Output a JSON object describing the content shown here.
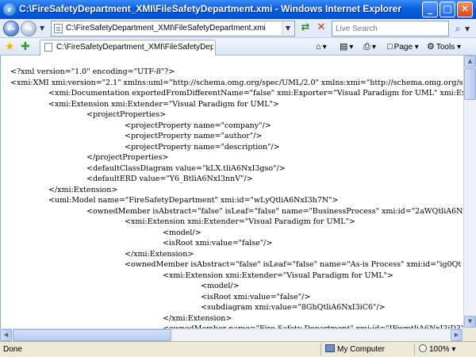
{
  "window": {
    "title": "C:\\FireSafetyDepartment_XMI\\FileSafetyDepartment.xmi - Windows Internet Explorer",
    "app_icon": "e",
    "minimize": "_",
    "maximize": "□",
    "close": "✕"
  },
  "nav": {
    "back_icon": "back-arrow-icon",
    "forward_icon": "forward-arrow-icon",
    "address": "C:\\FireSafetyDepartment_XMI\\FileSafetyDepartment.xmi",
    "search_placeholder": "Live Search"
  },
  "tabs": [
    {
      "title": "C:\\FireSafetyDepartment_XMI\\FileSafetyDepartment...."
    }
  ],
  "commands": {
    "page": "Page",
    "tools": "Tools"
  },
  "xml_lines": [
    "<?xml version=\"1.0\" encoding=\"UTF-8\"?>",
    "<xmi:XMI xmi:version=\"2.1\" xmlns:uml=\"http://schema.omg.org/spec/UML/2.0\" xmlns:xmi=\"http://schema.omg.org/sp",
    "<xmi:Documentation exportedFromDifferentName=\"false\" xmi:Exporter=\"Visual Paradigm for UML\" xmi:Expo",
    "<xmi:Extension xmi:Extender=\"Visual Paradigm for UML\">",
    "<projectProperties>",
    "<projectProperty name=\"company\"/>",
    "<projectProperty name=\"author\"/>",
    "<projectProperty name=\"description\"/>",
    "</projectProperties>",
    "<defaultClassDiagram value=\"kLX.tliA6NxI3gso\"/>",
    "<defaultERD value=\"Y6_BtliA6NxI3nnV\"/>",
    "</xmi:Extension>",
    "<uml:Model name=\"FireSafetyDepartment\" xmi:id=\"wLyQtliA6NxI3h7N\">",
    "<ownedMember isAbstract=\"false\" isLeaf=\"false\" name=\"BusinessProcess\" xmi:id=\"2aWQtliA6NxI3",
    "<xmi:Extension xmi:Extender=\"Visual Paradigm for UML\">",
    "<model/>",
    "<isRoot xmi:value=\"false\"/>",
    "</xmi:Extension>",
    "<ownedMember isAbstract=\"false\" isLeaf=\"false\" name=\"As-is Process\" xmi:id=\"ig0Qt",
    "<xmi:Extension xmi:Extender=\"Visual Paradigm for UML\">",
    "<model/>",
    "<isRoot xmi:value=\"false\"/>",
    "<subdiagram xmi:value=\"8GhQtliA6NxI3iC6\"/>",
    "</xmi:Extension>",
    "<ownedMember name=\"Fire Safety Department\" xmi:id=\"IFwmtliA6NxI3jD3\" xmi"
  ],
  "status": {
    "text": "Done",
    "zone": "My Computer",
    "zoom": "100%"
  }
}
